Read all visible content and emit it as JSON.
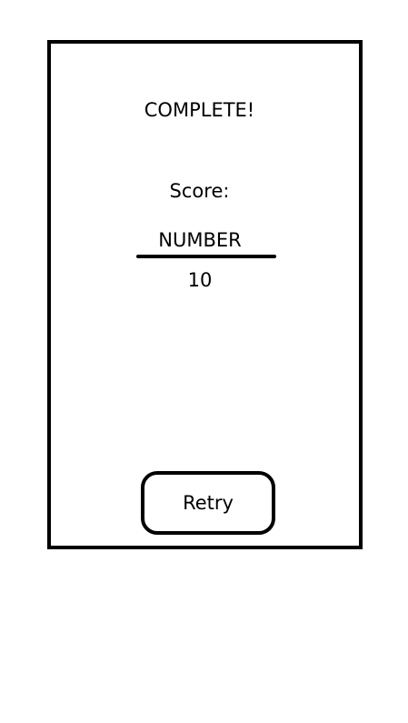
{
  "screen": {
    "title": "COMPLETE!",
    "score_label": "Score:",
    "fraction": {
      "numerator": "NUMBER",
      "denominator": "10"
    },
    "retry_label": "Retry"
  },
  "colors": {
    "background": "#ffffff",
    "stroke": "#000000"
  }
}
